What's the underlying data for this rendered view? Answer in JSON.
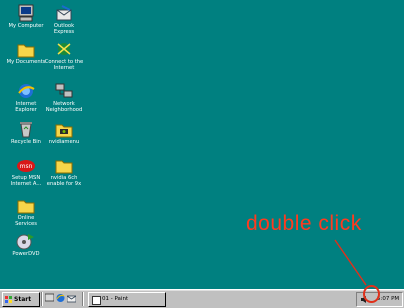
{
  "desktop": {
    "icons": [
      {
        "label": "My Computer",
        "icon": "computer-icon"
      },
      {
        "label": "Outlook\nExpress",
        "icon": "outlook-express-icon"
      },
      {
        "label": "My Documents",
        "icon": "folder-icon"
      },
      {
        "label": "Connect to the\nInternet",
        "icon": "connect-internet-icon"
      },
      {
        "label": "Internet\nExplorer",
        "icon": "internet-explorer-icon"
      },
      {
        "label": "Network\nNeighborhood",
        "icon": "network-icon"
      },
      {
        "label": "Recycle Bin",
        "icon": "recycle-bin-icon"
      },
      {
        "label": "nvidiamenu",
        "icon": "nvidia-folder-icon"
      },
      {
        "label": "Setup MSN\nInternet A...",
        "icon": "msn-icon"
      },
      {
        "label": "nvidia 6ch\nenable for 9x",
        "icon": "folder-icon"
      },
      {
        "label": "Online\nServices",
        "icon": "folder-icon"
      },
      {
        "label": "PowerDVD",
        "icon": "powerdvd-icon"
      }
    ]
  },
  "annotation": {
    "text": "double click",
    "color": "#ff3b1f"
  },
  "taskbar": {
    "start_label": "Start",
    "task_button": "01 - Paint",
    "clock": "5:07 PM"
  },
  "colors": {
    "desktop": "#008080",
    "taskbar": "#c0c0c0"
  }
}
